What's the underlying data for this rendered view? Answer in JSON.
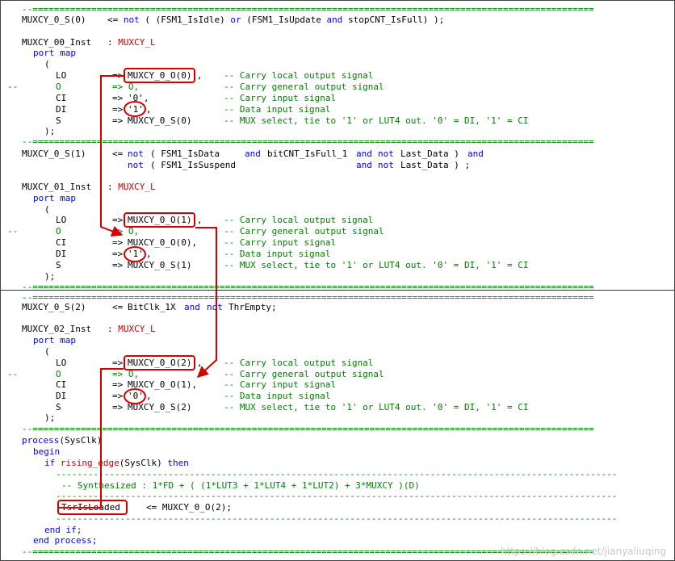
{
  "sep_eq": "--=========================================================================================================",
  "sep_dash": "---------------------------------------------------------------------------------------------------------",
  "c1": {
    "target": "MUXCY_0_S(0)",
    "assign_op": "<=",
    "not": "not",
    "lp": "(",
    "sig_a": "(FSM1_IsIdle)",
    "or_a": "or",
    "sig_b": "(FSM1_IsUpdate",
    "and_b": "and",
    "sig_c": "stopCNT_IsFull) );",
    "inst_name": "MUXCY_00_Inst",
    "inst_colon": ":",
    "inst_comp": "MUXCY_L",
    "port_map": "port map",
    "open_paren": "(",
    "lo_name": "LO",
    "lo_arrow": "=>",
    "lo_val": "MUXCY_0_O(0)",
    "lo_comma": ",",
    "lo_cmt": "-- Carry local output signal",
    "o_prefix": "--",
    "o_name": "O",
    "o_arrow": "=> O,",
    "o_cmt": "-- Carry general output signal",
    "ci_name": "CI",
    "ci_arrow": "=>",
    "ci_val": "'0',",
    "ci_cmt": "-- Carry input signal",
    "di_name": "DI",
    "di_arrow": "=>",
    "di_val": "'1'",
    "di_comma": ",",
    "di_cmt": "-- Data input signal",
    "s_name": "S",
    "s_arrow": "=>",
    "s_val": "MUXCY_0_S(0)",
    "s_cmt": "-- MUX select, tie to '1' or LUT4 out. '0' = DI, '1' = CI",
    "close_paren": ");"
  },
  "c2": {
    "target": "MUXCY_0_S(1)",
    "assign_op": "<=",
    "not": "not",
    "l1_a": "( FSM1_IsData",
    "l1_and": "and",
    "l1_b": "bitCNT_IsFull_1",
    "l1_and2": "and",
    "l1_not": "not",
    "l1_c": "Last_Data )",
    "l1_and3": "and",
    "l2_not": "not",
    "l2_a": "( FSM1_IsSuspend",
    "l2_and": "and",
    "l2_not2": "not",
    "l2_b": "Last_Data ) ;",
    "inst_name": "MUXCY_01_Inst",
    "inst_colon": ":",
    "inst_comp": "MUXCY_L",
    "port_map": "port map",
    "open_paren": "(",
    "lo_name": "LO",
    "lo_arrow": "=>",
    "lo_val": "MUXCY_0_O(1)",
    "lo_comma": ",",
    "lo_cmt": "-- Carry local output signal",
    "o_prefix": "--",
    "o_name": "O",
    "o_arrow": "=> O,",
    "o_cmt": "-- Carry general output signal",
    "ci_name": "CI",
    "ci_arrow": "=>",
    "ci_val": "MUXCY_0_O(0),",
    "ci_cmt": "-- Carry input signal",
    "di_name": "DI",
    "di_arrow": "=>",
    "di_val": "'1'",
    "di_comma": ",",
    "di_cmt": "-- Data input signal",
    "s_name": "S",
    "s_arrow": "=>",
    "s_val": "MUXCY_0_S(1)",
    "s_cmt": "-- MUX select, tie to '1' or LUT4 out. '0' = DI, '1' = CI",
    "close_paren": ");"
  },
  "c3": {
    "target": "MUXCY_0_S(2)",
    "assign_op": "<=",
    "sig_a": "BitClk_1X",
    "and_a": "and",
    "not_a": "not",
    "sig_b": "ThrEmpty;",
    "inst_name": "MUXCY_02_Inst",
    "inst_colon": ":",
    "inst_comp": "MUXCY_L",
    "port_map": "port map",
    "open_paren": "(",
    "lo_name": "LO",
    "lo_arrow": "=>",
    "lo_val": "MUXCY_0_O(2)",
    "lo_comma": ",",
    "lo_cmt": "-- Carry local output signal",
    "o_prefix": "--",
    "o_name": "O",
    "o_arrow": "=> O,",
    "o_cmt": "-- Carry general output signal",
    "ci_name": "CI",
    "ci_arrow": "=>",
    "ci_val": "MUXCY_0_O(1),",
    "ci_cmt": "-- Carry input signal",
    "di_name": "DI",
    "di_arrow": "=>",
    "di_val": "'0'",
    "di_comma": ",",
    "di_cmt": "-- Data input signal",
    "s_name": "S",
    "s_arrow": "=>",
    "s_val": "MUXCY_0_S(2)",
    "s_cmt": "-- MUX select, tie to '1' or LUT4 out. '0' = DI, '1' = CI",
    "close_paren": ");"
  },
  "proc": {
    "process_kw": "process",
    "process_arg": "(SysClk)",
    "begin_kw": "begin",
    "if_kw": "if",
    "rising": "rising_edge",
    "if_arg": "(SysClk)",
    "then_kw": "then",
    "synth_cmt": "-- Synthesized : 1*FD + ( (1*LUT3 + 1*LUT4 + 1*LUT2) + 3*MUXCY )(D)",
    "tsr_name": "TsrIsLoaded",
    "tsr_assign": "<= MUXCY_0_O(2);",
    "end_if": "end if;",
    "end_process": "end process;"
  },
  "watermark": "https://blog.csdn.net/jianyaliuqing",
  "colors": {
    "comment": "#008000",
    "keyword": "#0000ff",
    "type": "#cc0000",
    "annotation": "#d40000"
  }
}
